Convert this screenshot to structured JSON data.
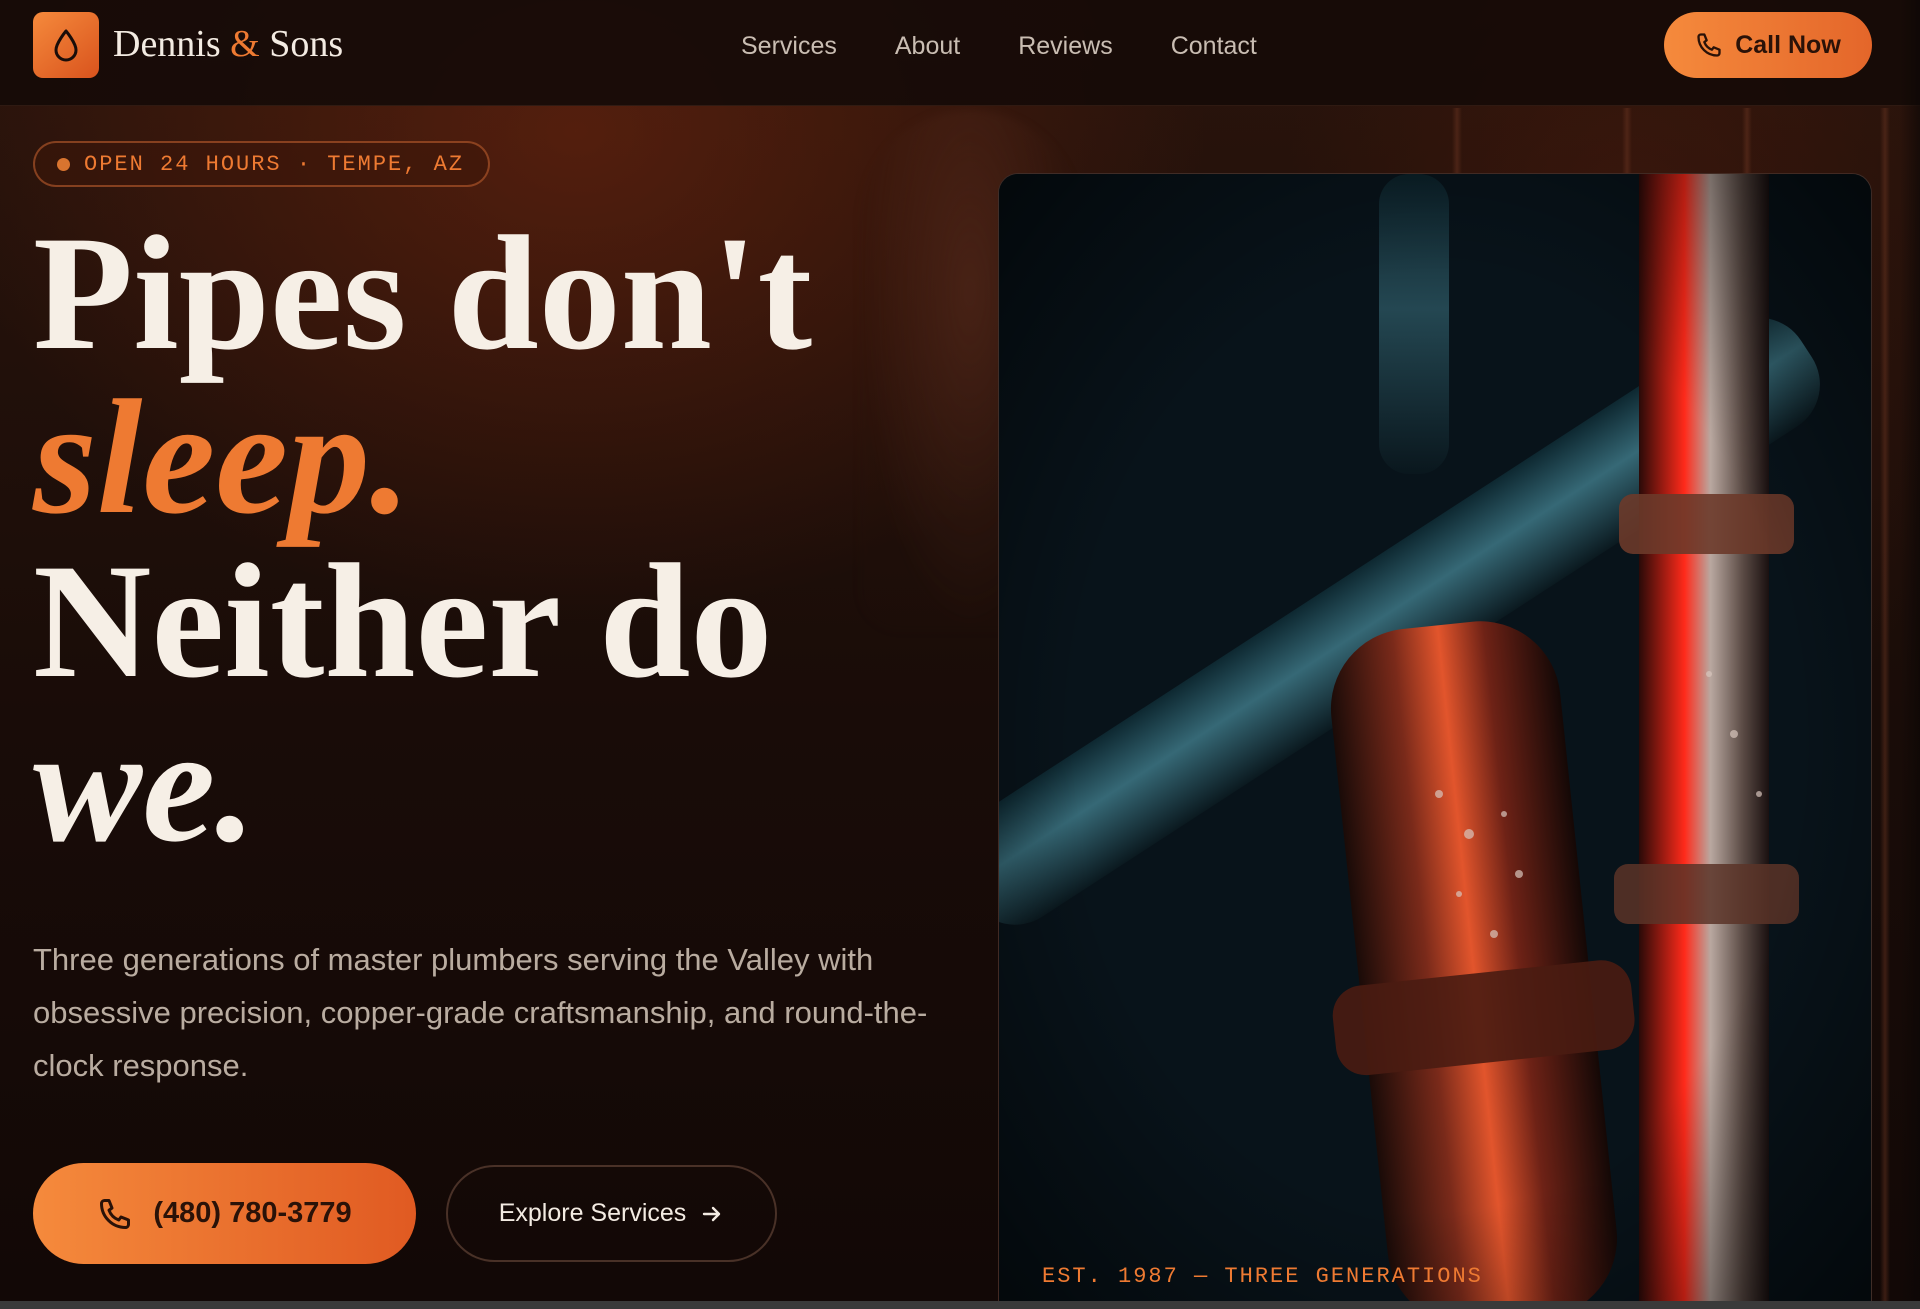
{
  "brand": {
    "name_left": "Dennis",
    "amp": "&",
    "name_right": "Sons",
    "logo_icon": "water-drop-icon"
  },
  "nav": {
    "items": [
      "Services",
      "About",
      "Reviews",
      "Contact"
    ]
  },
  "header": {
    "cta_label": "Call Now",
    "cta_icon": "phone-icon"
  },
  "hero": {
    "badge": "OPEN 24 HOURS · TEMPE, AZ",
    "headline": {
      "line1": "Pipes don't",
      "line2": "sleep.",
      "line3": "Neither do",
      "line4": "we."
    },
    "subtext": "Three generations of master plumbers serving the Valley with obsessive precision, copper-grade craftsmanship, and round-the-clock response.",
    "phone_button": "(480) 780-3779",
    "explore_button": "Explore Services",
    "explore_icon": "arrow-right-icon"
  },
  "panel": {
    "caption": "EST. 1987 — THREE GENERATIONS"
  },
  "colors": {
    "accent": "#ee7a32",
    "accent_dark": "#d9531d",
    "background": "#1a0d09",
    "text": "#f3ebe2"
  }
}
